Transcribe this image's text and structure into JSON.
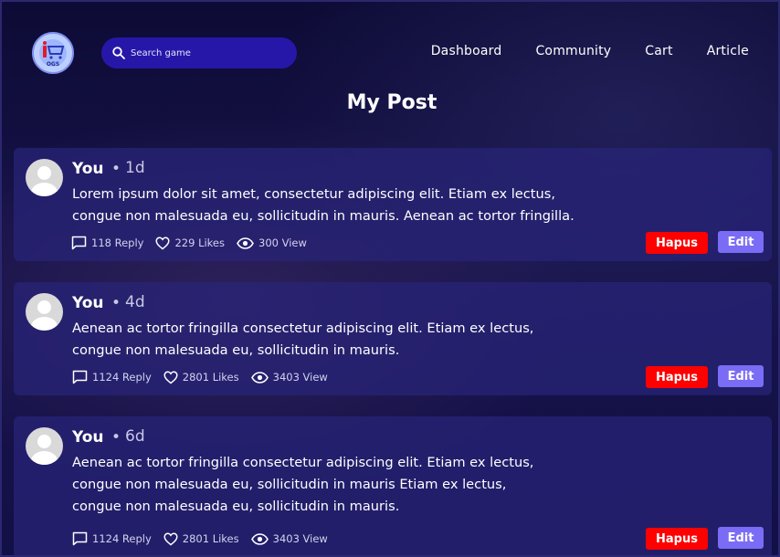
{
  "header": {
    "logo_text": "OGS",
    "search_placeholder": "Search game",
    "nav": [
      "Dashboard",
      "Community",
      "Cart",
      "Article"
    ]
  },
  "page_title": "My Post",
  "posts": [
    {
      "author": "You",
      "separator": "•",
      "time": "1d",
      "lines": [
        "Lorem ipsum dolor sit amet, consectetur adipiscing elit. Etiam ex lectus,",
        "congue non malesuada eu, sollicitudin in mauris. Aenean ac tortor fringilla."
      ],
      "reply": "118 Reply",
      "likes": "229 Likes",
      "views": "300 View",
      "delete_label": "Hapus",
      "edit_label": "Edit"
    },
    {
      "author": "You",
      "separator": "•",
      "time": "4d",
      "lines": [
        "Aenean ac tortor fringilla consectetur adipiscing elit. Etiam ex lectus,",
        "congue non malesuada eu, sollicitudin in mauris."
      ],
      "reply": "1124 Reply",
      "likes": "2801 Likes",
      "views": "3403 View",
      "delete_label": "Hapus",
      "edit_label": "Edit"
    },
    {
      "author": "You",
      "separator": "•",
      "time": "6d",
      "lines": [
        "Aenean ac tortor fringilla consectetur adipiscing elit. Etiam ex lectus,",
        "congue non malesuada eu, sollicitudin in mauris  Etiam ex lectus,",
        "congue non malesuada eu, sollicitudin in mauris."
      ],
      "reply": "1124 Reply",
      "likes": "2801 Likes",
      "views": "3403 View",
      "delete_label": "Hapus",
      "edit_label": "Edit"
    }
  ],
  "colors": {
    "background": "#12103e",
    "search_bg": "#2717a8",
    "card_bg": "#28247a",
    "delete_button": "#ff0000",
    "edit_button": "#7b6cf5"
  },
  "icons": {
    "logo": "shopping-cart-logo-icon",
    "search": "search-icon",
    "reply": "chat-bubble-icon",
    "likes": "heart-icon",
    "views": "eye-icon",
    "avatar": "user-avatar-icon"
  }
}
